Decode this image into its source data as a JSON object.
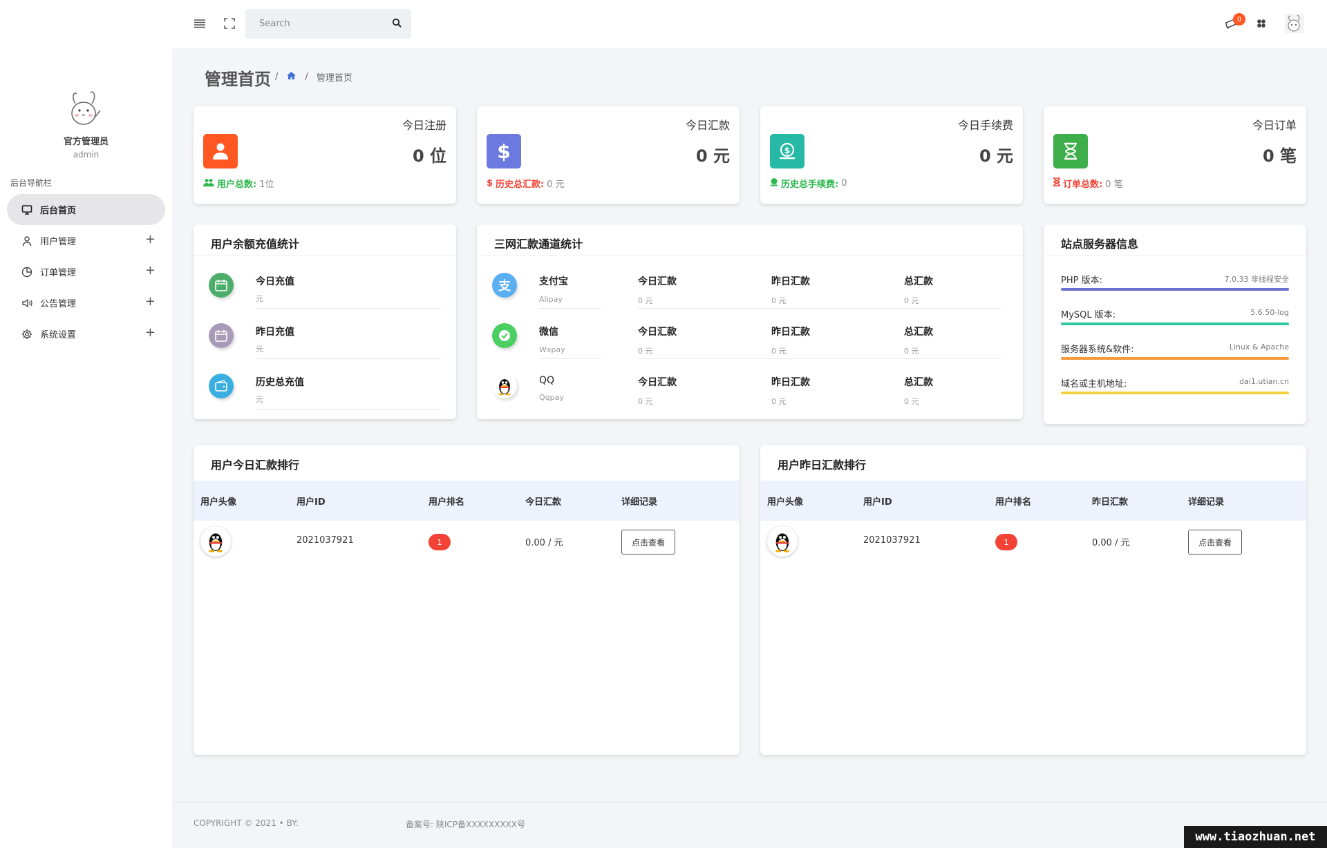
{
  "sidebar": {
    "user_name": "官方管理员",
    "user_role": "admin",
    "section_label": "后台导航栏",
    "items": [
      {
        "label": "后台首页",
        "icon": "monitor-icon"
      },
      {
        "label": "用户管理",
        "icon": "user-icon",
        "expand": "+"
      },
      {
        "label": "订单管理",
        "icon": "pie-chart-icon",
        "expand": "+"
      },
      {
        "label": "公告管理",
        "icon": "speaker-icon",
        "expand": "+"
      },
      {
        "label": "系统设置",
        "icon": "gear-icon",
        "expand": "+"
      }
    ]
  },
  "topbar": {
    "search_placeholder": "Search",
    "notification_count": "0"
  },
  "breadcrumb": {
    "title": "管理首页",
    "sep": "/",
    "current": "管理首页"
  },
  "stats": [
    {
      "label": "今日注册",
      "value": "0 位",
      "foot_label": "用户总数:",
      "foot_value": "1位",
      "color": "#ff5722",
      "foot_color": "#2db84d"
    },
    {
      "label": "今日汇款",
      "value": "0 元",
      "foot_label": "历史总汇款:",
      "foot_value": "0 元",
      "color": "#6c7ae0",
      "foot_color": "#f44336"
    },
    {
      "label": "今日手续费",
      "value": "0 元",
      "foot_label": "历史总手续费:",
      "foot_value": "0",
      "color": "#26b9a6",
      "foot_color": "#2db84d"
    },
    {
      "label": "今日订单",
      "value": "0 笔",
      "foot_label": "订单总数:",
      "foot_value": "0 笔",
      "color": "#3eae4a",
      "foot_color": "#f44336"
    }
  ],
  "recharge": {
    "title": "用户余额充值统计",
    "rows": [
      {
        "label": "今日充值",
        "sub": "元",
        "color": "#4cae6a"
      },
      {
        "label": "昨日充值",
        "sub": "元",
        "color": "#a89bb8"
      },
      {
        "label": "历史总充值",
        "sub": "元",
        "color": "#3aaee0"
      }
    ]
  },
  "channels": {
    "title": "三网汇款通道统计",
    "rows": [
      {
        "name": "支付宝",
        "code": "Alipay",
        "today_label": "今日汇款",
        "today": "0 元",
        "yday_label": "昨日汇款",
        "yday": "0 元",
        "total_label": "总汇款",
        "total": "0 元"
      },
      {
        "name": "微信",
        "code": "Wxpay",
        "today_label": "今日汇款",
        "today": "0 元",
        "yday_label": "昨日汇款",
        "yday": "0 元",
        "total_label": "总汇款",
        "total": "0 元"
      },
      {
        "name": "QQ",
        "code": "Qqpay",
        "today_label": "今日汇款",
        "today": "0 元",
        "yday_label": "昨日汇款",
        "yday": "0 元",
        "total_label": "总汇款",
        "total": "0 元"
      }
    ]
  },
  "server": {
    "title": "站点服务器信息",
    "rows": [
      {
        "key": "PHP 版本:",
        "value": "7.0.33 非线程安全",
        "color": "#6a6fd0"
      },
      {
        "key": "MySQL 版本:",
        "value": "5.6.50-log",
        "color": "#2ec9a0"
      },
      {
        "key": "服务器系统&软件:",
        "value": "Linux & Apache",
        "color": "#f79a3b"
      },
      {
        "key": "域名或主机地址:",
        "value": "dai1.utian.cn",
        "color": "#f4d03f"
      }
    ]
  },
  "rank_today": {
    "title": "用户今日汇款排行",
    "headers": [
      "用户头像",
      "用户ID",
      "用户排名",
      "今日汇款",
      "详细记录"
    ],
    "rows": [
      {
        "id": "2021037921",
        "rank": "1",
        "amount": "0.00 / 元",
        "action": "点击查看"
      }
    ]
  },
  "rank_yesterday": {
    "title": "用户昨日汇款排行",
    "headers": [
      "用户头像",
      "用户ID",
      "用户排名",
      "昨日汇款",
      "详细记录"
    ],
    "rows": [
      {
        "id": "2021037921",
        "rank": "1",
        "amount": "0.00 / 元",
        "action": "点击查看"
      }
    ]
  },
  "footer": {
    "copyright": "COPYRIGHT © 2021 • BY:",
    "icp": "备案号: 陕ICP备XXXXXXXXX号"
  },
  "watermark": "www.tiaozhuan.net"
}
